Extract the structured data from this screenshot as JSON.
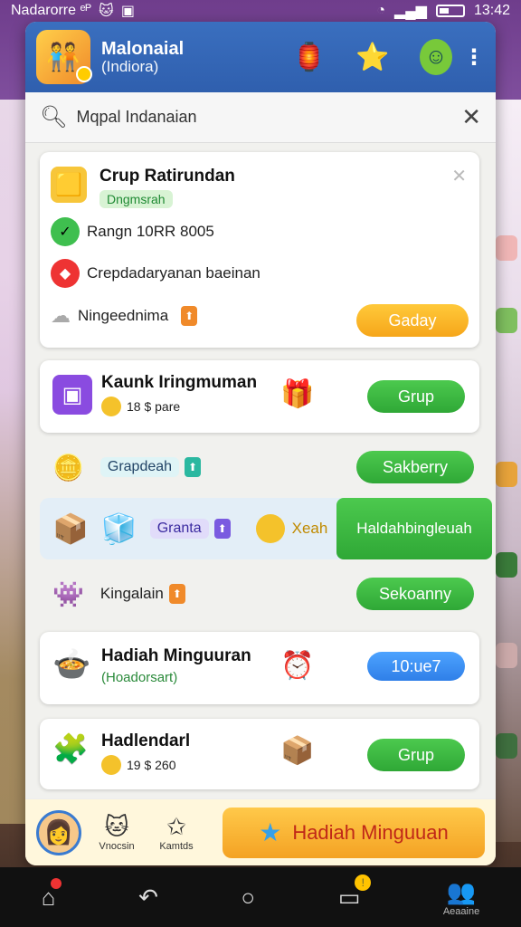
{
  "status_bar": {
    "carrier": "Nadarorre ᵉᴾ",
    "time": "13:42"
  },
  "header": {
    "title": "Malonaial",
    "subtitle": "(Indiora)"
  },
  "search": {
    "value": "Mqpal Indanaian"
  },
  "card1": {
    "title": "Crup Ratirundan",
    "tag": "Dngmsrah",
    "line1": "Rangn 10RR 8005",
    "line2": "Crepdadaryanan baeinan",
    "line3": "Ningeednima",
    "button": "Gaday"
  },
  "card2": {
    "title": "Kaunk Iringmuman",
    "coins": "18 $ pare",
    "button": "Grup"
  },
  "row3": {
    "label": "Grapdeah",
    "button": "Sakberry"
  },
  "row4": {
    "pill": "Granta",
    "mid": "Xeah",
    "button": "Haldahbingleuah"
  },
  "row5": {
    "label": "Kingalain",
    "button": "Sekoanny"
  },
  "card6": {
    "title": "Hadiah Minguuran",
    "sub": "(Hoadorsart)",
    "button": "10:ue7"
  },
  "card7": {
    "title": "Hadlendarl",
    "coins": "19 $ 260",
    "button": "Grup"
  },
  "bottom": {
    "mini1": "Vnocsin",
    "mini2": "Kamtds",
    "cta": "Hadiah Minguuan"
  },
  "nav": {
    "label5": "Aeaaine"
  },
  "colors": {
    "accent_blue": "#2f5fae",
    "green_button": "#2fa836",
    "orange_button": "#f6a61a"
  }
}
